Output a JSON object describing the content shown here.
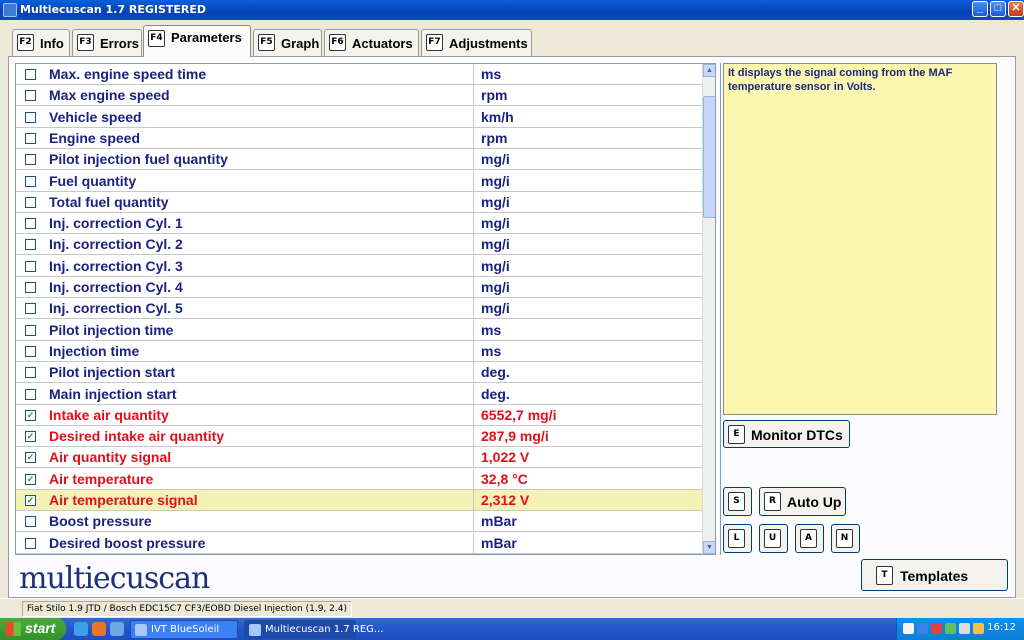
{
  "window": {
    "title": "Multiecuscan 1.7 REGISTERED",
    "min_glyph": "_",
    "max_glyph": "□",
    "close_glyph": "✕"
  },
  "tabs": [
    {
      "key": "F2",
      "label": "Info"
    },
    {
      "key": "F3",
      "label": "Errors"
    },
    {
      "key": "F4",
      "label": "Parameters",
      "active": true
    },
    {
      "key": "F5",
      "label": "Graph"
    },
    {
      "key": "F6",
      "label": "Actuators"
    },
    {
      "key": "F7",
      "label": "Adjustments"
    }
  ],
  "parameters": [
    {
      "name": "Max. engine speed time",
      "value": "ms",
      "checked": false
    },
    {
      "name": "Max engine speed",
      "value": "rpm",
      "checked": false
    },
    {
      "name": "Vehicle speed",
      "value": "km/h",
      "checked": false
    },
    {
      "name": "Engine speed",
      "value": "rpm",
      "checked": false
    },
    {
      "name": "Pilot injection fuel quantity",
      "value": "mg/i",
      "checked": false
    },
    {
      "name": "Fuel quantity",
      "value": "mg/i",
      "checked": false
    },
    {
      "name": "Total fuel quantity",
      "value": "mg/i",
      "checked": false
    },
    {
      "name": "Inj. correction Cyl. 1",
      "value": "mg/i",
      "checked": false
    },
    {
      "name": "Inj. correction Cyl. 2",
      "value": "mg/i",
      "checked": false
    },
    {
      "name": "Inj. correction Cyl. 3",
      "value": "mg/i",
      "checked": false
    },
    {
      "name": "Inj. correction Cyl. 4",
      "value": "mg/i",
      "checked": false
    },
    {
      "name": "Inj. correction Cyl. 5",
      "value": "mg/i",
      "checked": false
    },
    {
      "name": "Pilot injection time",
      "value": "ms",
      "checked": false
    },
    {
      "name": "Injection time",
      "value": "ms",
      "checked": false
    },
    {
      "name": "Pilot injection start",
      "value": "deg.",
      "checked": false
    },
    {
      "name": "Main injection start",
      "value": "deg.",
      "checked": false
    },
    {
      "name": "Intake air quantity",
      "value": "6552,7 mg/i",
      "checked": true
    },
    {
      "name": "Desired intake air quantity",
      "value": "287,9 mg/i",
      "checked": true
    },
    {
      "name": "Air quantity signal",
      "value": "1,022 V",
      "checked": true
    },
    {
      "name": "Air temperature",
      "value": "32,8 °C",
      "checked": true
    },
    {
      "name": "Air temperature signal",
      "value": "2,312 V",
      "checked": true,
      "highlighted": true
    },
    {
      "name": "Boost pressure",
      "value": "mBar",
      "checked": false
    },
    {
      "name": "Desired boost pressure",
      "value": "mBar",
      "checked": false
    }
  ],
  "description": "It displays the signal coming from the MAF temperature sensor in Volts.",
  "buttons": {
    "monitor_dtcs": {
      "key": "E",
      "label": "Monitor DTCs"
    },
    "s": {
      "key": "S"
    },
    "auto_up": {
      "key": "R",
      "label": "Auto Up"
    },
    "l": {
      "key": "L"
    },
    "u": {
      "key": "U"
    },
    "a": {
      "key": "A"
    },
    "n": {
      "key": "N"
    },
    "templates": {
      "key": "T",
      "label": "Templates"
    }
  },
  "brand": "multiecuscan",
  "status": "Fiat Stilo 1.9 JTD / Bosch EDC15C7 CF3/EOBD Diesel Injection (1.9, 2.4)",
  "taskbar": {
    "start": "start",
    "tasks": [
      {
        "label": "IVT BlueSoleil",
        "active": false
      },
      {
        "label": "Multiecuscan 1.7 REG...",
        "active": true
      }
    ],
    "clock": "16:12"
  },
  "colors": {
    "active_param": "#e0101a",
    "param_text": "#1a237e",
    "highlight_row": "#f5f0b4",
    "description_bg": "#fbf6b0"
  }
}
